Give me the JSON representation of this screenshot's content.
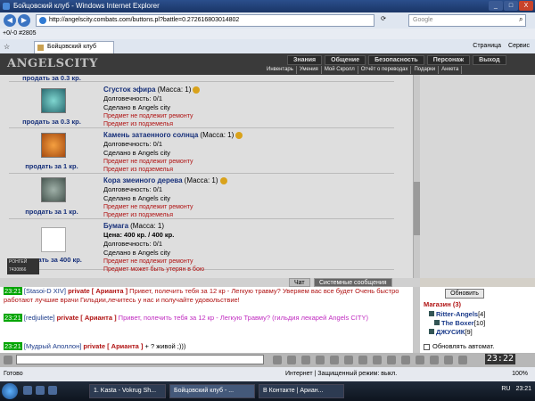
{
  "window": {
    "title": "Бойцовский клуб - Windows Internet Explorer",
    "buttons": [
      "_",
      "□",
      "X"
    ]
  },
  "address_bar": {
    "url": "http://angelscity.combats.com/buttons.pl?battle=0.272616803014802",
    "search_placeholder": "Google"
  },
  "links_bar": {
    "text": "+0/-0  #2805"
  },
  "tab_bar": {
    "tab_label": "Бойцовский клуб",
    "tools": [
      "Страница",
      "Сервис"
    ]
  },
  "game_header": {
    "logo": "ANGELSCITY",
    "main_menu": [
      "Знания",
      "Общение",
      "Безопасность",
      "Персонаж",
      "Выход"
    ],
    "sub_menu": [
      "Инвентарь",
      "Умения",
      "Мой Скролл",
      "Отчёт о переводах",
      "Подарки",
      "Анкета"
    ]
  },
  "items": [
    {
      "price": "продать за 0.3 кр.",
      "partial": true
    },
    {
      "name": "Сгусток эфира",
      "mass": "(Масса: 1)",
      "durability": "Долговечность: 0/1",
      "made_in": "Сделано в Angels city",
      "note1": "Предмет не подлежит ремонту",
      "note2": "Предмет из подземелья",
      "price": "продать за 0.3 кр."
    },
    {
      "name": "Камень затаенного солнца",
      "mass": "(Масса: 1)",
      "durability": "Долговечность: 0/1",
      "made_in": "Сделано в Angels city",
      "note1": "Предмет не подлежит ремонту",
      "note2": "Предмет из подземелья",
      "price": "продать за 1 кр."
    },
    {
      "name": "Кора змеиного дерева",
      "mass": "(Масса: 1)",
      "durability": "Долговечность: 0/1",
      "made_in": "Сделано в Angels city",
      "note1": "Предмет не подлежит ремонту",
      "note2": "Предмет из подземелья",
      "price": "продать за 1 кр."
    },
    {
      "name": "Бумага",
      "mass": "(Масса: 1)",
      "price_line": "Цена: 400 кр. / 400 кр.",
      "durability": "Долговечность: 0/1",
      "made_in": "Сделано в Angels city",
      "note1": "Предмет не подлежит ремонту",
      "note2": "Предмет может быть утерян в бою",
      "price": "продать за 400 кр."
    }
  ],
  "counter_badge": "РОНГЕЙ 7430866",
  "chat_tabs": [
    "Чат",
    "Системные сообщения"
  ],
  "chat": [
    {
      "time": "23:21",
      "nick": "[Stasoi-D XIV]",
      "private": "private [ Арианта ]",
      "text": "Привет, полечить тебя за 12 кр - Легкую травму?",
      "extra": "Уверяем вас все будет Очень быстро работают лучшие врачи Гильдии,лечитесь у нас и получайте удовольствие!"
    },
    {
      "time": "23:21",
      "nick": "[redjuliete]",
      "private": "private [ Арианта ]",
      "text": "Привет, полечить тебя за 12 кр - Легкую Травму?",
      "extra": "(гильдия лекарей Angels CITY)"
    },
    {
      "time": "23:21",
      "nick": "[Мудрый Аполлон]",
      "private": "private [ Арианта ]",
      "text": "+ ? живой ;)))"
    }
  ],
  "shop": {
    "refresh_label": "Обновить",
    "title": "Магазин (3)",
    "users": [
      {
        "name": "Ritter-Angels",
        "level": "[4]"
      },
      {
        "name": "The Boxer",
        "level": "[10]"
      },
      {
        "name": "ДЖУСИК",
        "level": "[9]"
      }
    ],
    "auto_label": "Обновлять автомат."
  },
  "game_clock": "23:22",
  "status_bar": {
    "left": "Готово",
    "zone": "Интернет | Защищенный режим: выкл.",
    "zoom": "100%"
  },
  "taskbar": {
    "tasks": [
      "1. Kasta - Vokrug Sh...",
      "Бойцовский клуб - ...",
      "В Контакте | Ариан..."
    ],
    "lang": "RU",
    "time": "23:21"
  }
}
